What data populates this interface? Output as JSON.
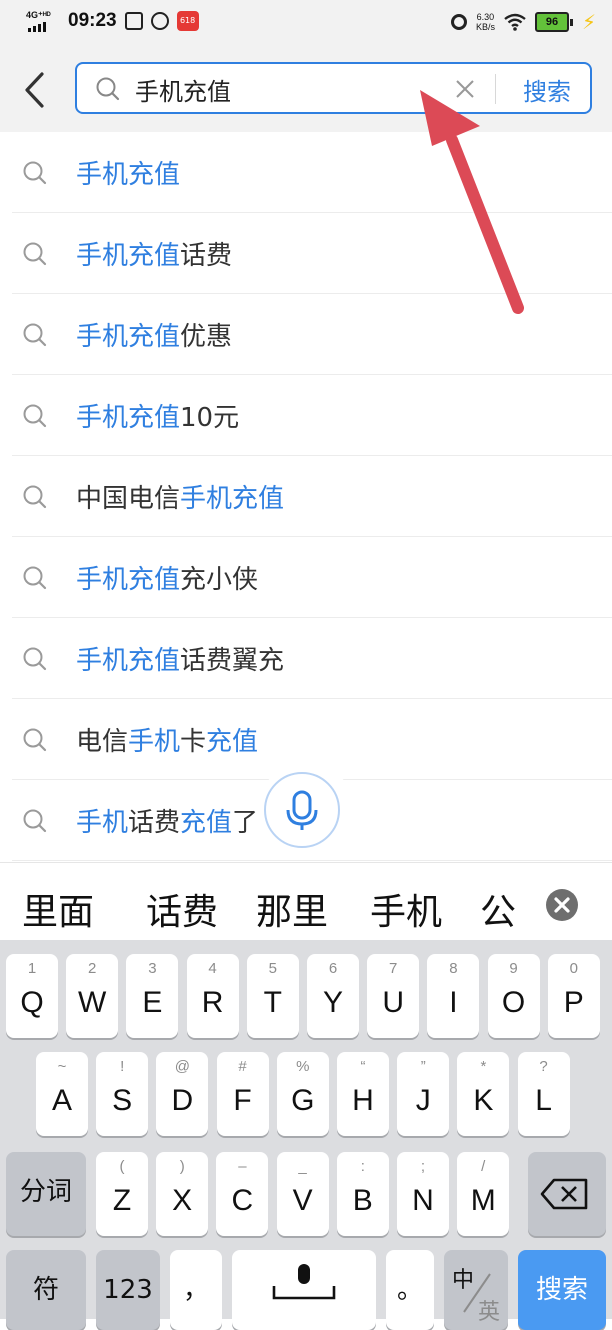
{
  "status_bar": {
    "network": "4G⁺ᴴᴰ",
    "time": "09:23",
    "app_badge": "618",
    "speed_value": "6.30",
    "speed_unit": "KB/s",
    "battery": "96"
  },
  "search": {
    "query": "手机充值",
    "submit_label": "搜索"
  },
  "suggestions": [
    {
      "parts": [
        {
          "t": "手机充值",
          "h": true
        }
      ]
    },
    {
      "parts": [
        {
          "t": "手机充值",
          "h": true
        },
        {
          "t": "话费",
          "h": false
        }
      ]
    },
    {
      "parts": [
        {
          "t": "手机充值",
          "h": true
        },
        {
          "t": "优惠",
          "h": false
        }
      ]
    },
    {
      "parts": [
        {
          "t": "手机充值",
          "h": true
        },
        {
          "t": "10元",
          "h": false
        }
      ]
    },
    {
      "parts": [
        {
          "t": "中国电信",
          "h": false
        },
        {
          "t": "手机充值",
          "h": true
        }
      ]
    },
    {
      "parts": [
        {
          "t": "手机充值",
          "h": true
        },
        {
          "t": "充小侠",
          "h": false
        }
      ]
    },
    {
      "parts": [
        {
          "t": "手机充值",
          "h": true
        },
        {
          "t": "话费翼充",
          "h": false
        }
      ]
    },
    {
      "parts": [
        {
          "t": "电信",
          "h": false
        },
        {
          "t": "手机",
          "h": true
        },
        {
          "t": "卡",
          "h": false
        },
        {
          "t": "充值",
          "h": true
        }
      ]
    },
    {
      "parts": [
        {
          "t": "手机",
          "h": true
        },
        {
          "t": "话费",
          "h": false
        },
        {
          "t": "充值",
          "h": true
        },
        {
          "t": "了",
          "h": false
        }
      ]
    }
  ],
  "candidates": [
    "里面",
    "话费",
    "那里",
    "手机",
    "公"
  ],
  "keyboard": {
    "row1": [
      {
        "num": "1",
        "letter": "Q"
      },
      {
        "num": "2",
        "letter": "W"
      },
      {
        "num": "3",
        "letter": "E"
      },
      {
        "num": "4",
        "letter": "R"
      },
      {
        "num": "5",
        "letter": "T"
      },
      {
        "num": "6",
        "letter": "Y"
      },
      {
        "num": "7",
        "letter": "U"
      },
      {
        "num": "8",
        "letter": "I"
      },
      {
        "num": "9",
        "letter": "O"
      },
      {
        "num": "0",
        "letter": "P"
      }
    ],
    "row2": [
      {
        "sym": "~",
        "letter": "A"
      },
      {
        "sym": "!",
        "letter": "S"
      },
      {
        "sym": "@",
        "letter": "D"
      },
      {
        "sym": "#",
        "letter": "F"
      },
      {
        "sym": "%",
        "letter": "G"
      },
      {
        "sym": "“",
        "letter": "H"
      },
      {
        "sym": "”",
        "letter": "J"
      },
      {
        "sym": "*",
        "letter": "K"
      },
      {
        "sym": "?",
        "letter": "L"
      }
    ],
    "row3": [
      {
        "sym": "(",
        "letter": "Z"
      },
      {
        "sym": ")",
        "letter": "X"
      },
      {
        "sym": "–",
        "letter": "C"
      },
      {
        "sym": "_",
        "letter": "V"
      },
      {
        "sym": ":",
        "letter": "B"
      },
      {
        "sym": ";",
        "letter": "N"
      },
      {
        "sym": "/",
        "letter": "M"
      }
    ],
    "segment_label": "分词",
    "symbol_label": "符",
    "number_label": "123",
    "comma": "，",
    "period": "。",
    "lang_primary": "中",
    "lang_secondary": "英",
    "enter_label": "搜索"
  }
}
